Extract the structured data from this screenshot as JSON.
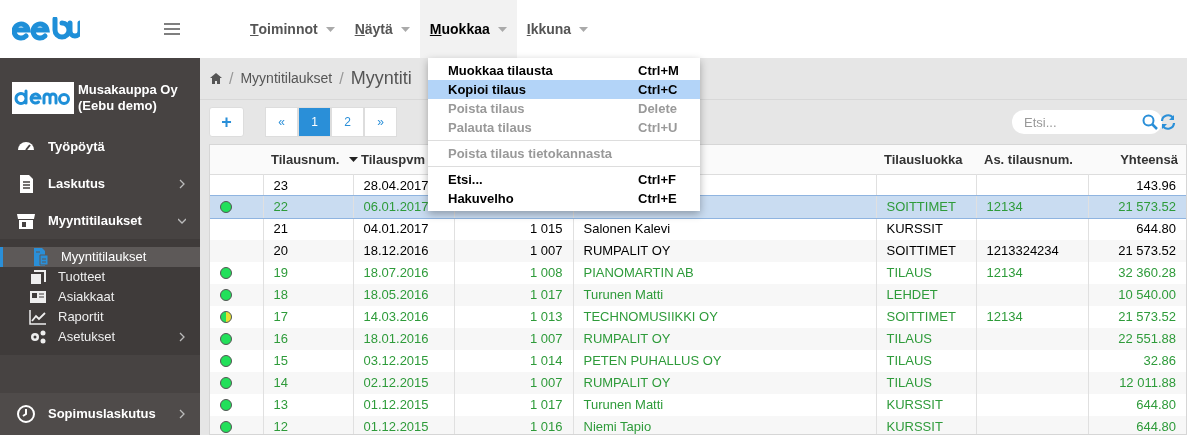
{
  "menubar": [
    {
      "key": "T",
      "rest": "oiminnot",
      "open": false
    },
    {
      "key": "N",
      "rest": "äytä",
      "open": false
    },
    {
      "key": "M",
      "rest": "uokkaa",
      "open": true
    },
    {
      "key": "I",
      "rest": "kkuna",
      "open": false
    }
  ],
  "menu": {
    "items": [
      {
        "label": "Muokkaa tilausta",
        "shortcut": "Ctrl+M",
        "selected": false,
        "disabled": false
      },
      {
        "label": "Kopioi tilaus",
        "shortcut": "Ctrl+C",
        "selected": true,
        "disabled": false
      },
      {
        "label": "Poista tilaus",
        "shortcut": "Delete",
        "selected": false,
        "disabled": true
      },
      {
        "label": "Palauta tilaus",
        "shortcut": "Ctrl+U",
        "selected": false,
        "disabled": true,
        "divider_after": true
      },
      {
        "label": "Poista tilaus tietokannasta",
        "selected": false,
        "disabled": true,
        "divider_after": true
      },
      {
        "label": "Etsi...",
        "shortcut": "Ctrl+F",
        "selected": false,
        "disabled": false
      },
      {
        "label": "Hakuvelho",
        "shortcut": "Ctrl+E",
        "selected": false,
        "disabled": false
      }
    ]
  },
  "company": {
    "name": "Musakauppa Oy",
    "subtitle": "(Eebu demo)"
  },
  "sidebar": {
    "items": [
      {
        "label": "Työpöytä",
        "expanded": false,
        "has_children": false
      },
      {
        "label": "Laskutus",
        "expanded": false,
        "has_children": true
      },
      {
        "label": "Myyntitilaukset",
        "expanded": true,
        "has_children": true,
        "children": [
          {
            "label": "Myyntitilaukset",
            "selected": true,
            "has_children": false
          },
          {
            "label": "Tuotteet",
            "selected": false,
            "has_children": false
          },
          {
            "label": "Asiakkaat",
            "selected": false,
            "has_children": false
          },
          {
            "label": "Raportit",
            "selected": false,
            "has_children": false
          },
          {
            "label": "Asetukset",
            "selected": false,
            "has_children": true
          }
        ]
      },
      {
        "label": "Sopimuslaskutus",
        "expanded": false,
        "has_children": true
      }
    ]
  },
  "breadcrumb": {
    "items": [
      "Myyntitilaukset"
    ],
    "separators": [
      "/",
      "/"
    ],
    "title": "Myyntiti"
  },
  "toolbar": {
    "add": "+",
    "pages": [
      {
        "label": "«",
        "selected": false
      },
      {
        "label": "1",
        "selected": true
      },
      {
        "label": "2",
        "selected": false
      },
      {
        "label": "»",
        "selected": false
      }
    ],
    "search": {
      "placeholder": "Etsi..."
    }
  },
  "table": {
    "columns": {
      "order_no": "Tilausnum.",
      "date": "Tilauspvm",
      "category": "Tilausluokka",
      "customer_order_no": "As. tilausnum.",
      "total": "Yhteensä"
    },
    "rows": [
      {
        "order_no": "23",
        "date": "28.04.2017",
        "total": "143.96",
        "selected": false
      },
      {
        "kind": "full",
        "color": "#22e05a",
        "order_no": "22",
        "date": "06.01.2017",
        "category": "SOITTIMET",
        "customer_order_no": "12134",
        "total": "21 573.52",
        "selected": true
      },
      {
        "order_no": "21",
        "date": "04.01.2017",
        "customer_no": "1 015",
        "customer": "Salonen Kalevi",
        "category": "KURSSIT",
        "total": "644.80",
        "selected": false
      },
      {
        "order_no": "20",
        "date": "18.12.2016",
        "customer_no": "1 007",
        "customer": "RUMPALIT OY",
        "category": "SOITTIMET",
        "customer_order_no": "1213324234",
        "total": "21 573.52",
        "selected": false
      },
      {
        "kind": "full",
        "color": "#22e05a",
        "order_no": "19",
        "date": "18.07.2016",
        "customer_no": "1 008",
        "customer": "PIANOMARTIN AB",
        "category": "TILAUS",
        "customer_order_no": "12134",
        "total": "32 360.28",
        "selected": false
      },
      {
        "kind": "full",
        "color": "#22e05a",
        "order_no": "18",
        "date": "18.05.2016",
        "customer_no": "1 017",
        "customer": "Turunen Matti",
        "category": "LEHDET",
        "total": "10 540.00",
        "selected": false
      },
      {
        "kind": "half",
        "color": "#e8e030",
        "order_no": "17",
        "date": "14.03.2016",
        "customer_no": "1 013",
        "customer": "TECHNOMUSIIKKI OY",
        "category": "SOITTIMET",
        "customer_order_no": "12134",
        "total": "21 573.52",
        "selected": false
      },
      {
        "kind": "full",
        "color": "#22e05a",
        "order_no": "16",
        "date": "18.01.2016",
        "customer_no": "1 007",
        "customer": "RUMPALIT OY",
        "category": "TILAUS",
        "total": "22 551.88",
        "selected": false
      },
      {
        "kind": "full",
        "color": "#22e05a",
        "order_no": "15",
        "date": "03.12.2015",
        "customer_no": "1 014",
        "customer": "PETEN PUHALLUS OY",
        "category": "TILAUS",
        "total": "32.86",
        "selected": false
      },
      {
        "kind": "full",
        "color": "#22e05a",
        "order_no": "14",
        "date": "02.12.2015",
        "customer_no": "1 007",
        "customer": "RUMPALIT OY",
        "category": "TILAUS",
        "total": "12 011.88",
        "selected": false
      },
      {
        "kind": "full",
        "color": "#22e05a",
        "order_no": "13",
        "date": "01.12.2015",
        "customer_no": "1 017",
        "customer": "Turunen Matti",
        "category": "KURSSIT",
        "total": "644.80",
        "selected": false
      },
      {
        "kind": "full",
        "color": "#22e05a",
        "order_no": "12",
        "date": "01.12.2015",
        "customer_no": "1 016",
        "customer": "Niemi Tapio",
        "category": "KURSSIT",
        "total": "644.80",
        "selected": false
      }
    ]
  }
}
